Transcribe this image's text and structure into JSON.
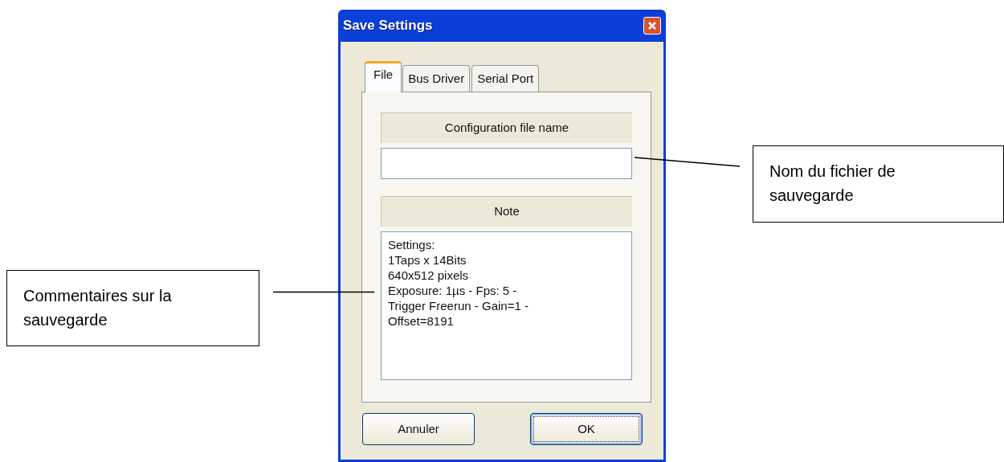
{
  "window": {
    "title": "Save Settings"
  },
  "tabs": [
    {
      "label": "File",
      "selected": true
    },
    {
      "label": "Bus Driver",
      "selected": false
    },
    {
      "label": "Serial Port",
      "selected": false
    }
  ],
  "file_name": {
    "label": "Configuration file name"
  },
  "note": {
    "label": "Note",
    "lines": [
      "Settings:",
      "1Taps x 14Bits",
      "640x512 pixels",
      "Exposure: 1µs - Fps: 5 -",
      "Trigger Freerun - Gain=1 -",
      "Offset=8191"
    ]
  },
  "buttons": [
    {
      "label": "Annuler",
      "default": false
    },
    {
      "label": "OK",
      "default": true
    }
  ],
  "callouts": [
    {
      "text": "Nom du fichier de sauvegarde"
    },
    {
      "text": "Commentaires sur la sauvegarde"
    }
  ]
}
